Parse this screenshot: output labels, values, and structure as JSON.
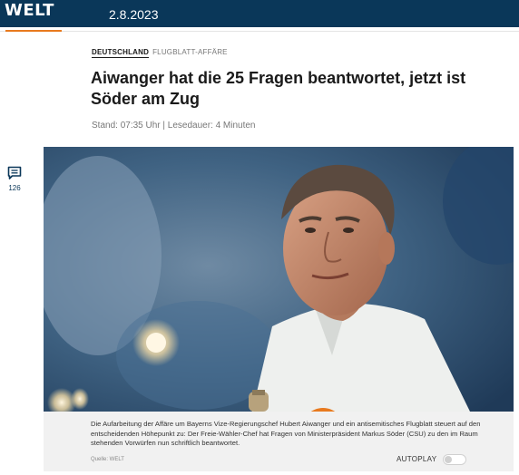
{
  "header": {
    "logo": "WELT",
    "date": "2.8.2023"
  },
  "article": {
    "category": "DEUTSCHLAND",
    "topic": "FLUGBLATT-AFFÄRE",
    "headline": "Aiwanger hat die 25 Fragen beantwortet, jetzt ist Söder am Zug",
    "meta": "Stand: 07:35 Uhr | Lesedauer: 4 Minuten"
  },
  "comments": {
    "icon": "comment-icon",
    "count": "126"
  },
  "video": {
    "play_icon": "play-icon",
    "caption": "Die Aufarbeitung der Affäre um Bayerns Vize-Regierungschef Hubert Aiwanger und ein antisemitisches Flugblatt steuert auf den entscheidenden Höhepunkt zu: Der Freie-Wähler-Chef hat Fragen von Ministerpräsident Markus Söder (CSU) zu den im Raum stehenden Vorwürfen nun schriftlich beantwortet.",
    "source": "Quelle: WELT",
    "autoplay_label": "AUTOPLAY",
    "autoplay_on": false
  },
  "colors": {
    "brand_navy": "#0a3759",
    "accent_orange": "#e87a1e"
  }
}
